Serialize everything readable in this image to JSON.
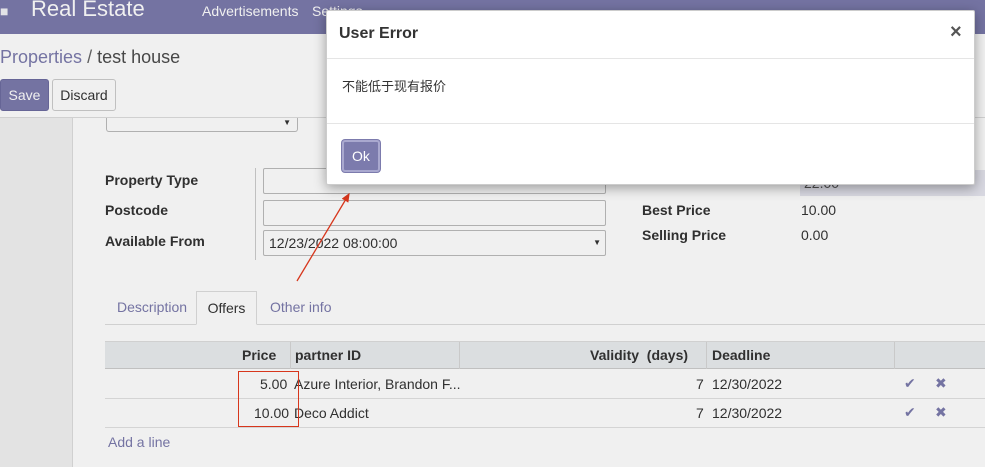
{
  "topnav": {
    "brand": "Real Estate",
    "menu": [
      "Advertisements",
      "Settings"
    ]
  },
  "control_panel": {
    "breadcrumb_parent": "Properties",
    "breadcrumb_sep": "/",
    "breadcrumb_current": "test house",
    "save_label": "Save",
    "discard_label": "Discard"
  },
  "form": {
    "property_type_label": "Property Type",
    "postcode_label": "Postcode",
    "available_from_label": "Available From",
    "available_from_value": "12/23/2022 08:00:00",
    "right_field_value": "22.00",
    "best_price_label": "Best Price",
    "best_price_value": "10.00",
    "selling_price_label": "Selling Price",
    "selling_price_value": "0.00"
  },
  "tabs": [
    "Description",
    "Offers",
    "Other info"
  ],
  "offers_table": {
    "headers": [
      "Price",
      "partner ID",
      "Validity  (days)",
      "Deadline"
    ],
    "rows": [
      {
        "price": "5.00",
        "partner": "Azure Interior, Brandon F...",
        "validity": "7",
        "deadline": "12/30/2022"
      },
      {
        "price": "10.00",
        "partner": "Deco Addict",
        "validity": "7",
        "deadline": "12/30/2022"
      }
    ],
    "add_line": "Add a line"
  },
  "dialog": {
    "title": "User Error",
    "close_glyph": "×",
    "message": "不能低于现有报价",
    "ok_label": "Ok"
  },
  "colors": {
    "brand": "#7c7bad",
    "annotation": "#e53a1e"
  }
}
